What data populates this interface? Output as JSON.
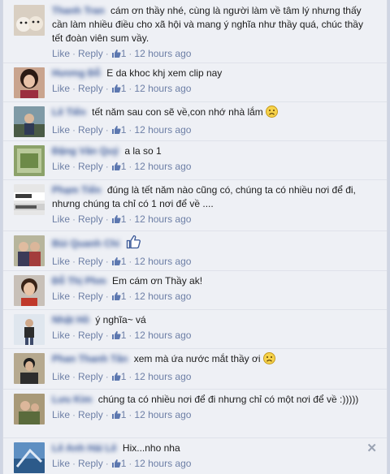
{
  "comments": [
    {
      "name": "Thanh Tran",
      "text": "cám ơn thầy nhé, cùng là người làm về tâm lý nhưng thấy cần làm nhiều điều cho xã hội và mang ý nghĩa như thầy quá, chúc thầy tết đoàn viên sum vầy.",
      "like": "Like",
      "reply": "Reply",
      "count": "1",
      "time": "12 hours ago"
    },
    {
      "name": "Hương Đỗ",
      "text": "E da khoc khj xem clip nay",
      "like": "Like",
      "reply": "Reply",
      "count": "1",
      "time": "12 hours ago"
    },
    {
      "name": "Lê Tiến",
      "text": "tết năm sau con sẽ về,con nhớ nhà lắm",
      "like": "Like",
      "reply": "Reply",
      "count": "1",
      "time": "12 hours ago"
    },
    {
      "name": "Đặng Văn Quý",
      "text": "a la so 1",
      "like": "Like",
      "reply": "Reply",
      "count": "1",
      "time": "12 hours ago"
    },
    {
      "name": "Phạm Tiến",
      "text": "đúng là tết năm nào cũng có, chúng ta có nhiều nơi để đi, nhưng chúng ta chỉ có 1 nơi để về ....",
      "like": "Like",
      "reply": "Reply",
      "count": "1",
      "time": "12 hours ago"
    },
    {
      "name": "Bùi Quanh Chi",
      "text": "",
      "like": "Like",
      "reply": "Reply",
      "count": "1",
      "time": "12 hours ago"
    },
    {
      "name": "Đỗ Thị Phm",
      "text": "Em cám ơn  Thầy ak!",
      "like": "Like",
      "reply": "Reply",
      "count": "1",
      "time": "12 hours ago"
    },
    {
      "name": "Nhật Hồ",
      "text": "ý nghĩa~ vá",
      "like": "Like",
      "reply": "Reply",
      "count": "1",
      "time": "12 hours ago"
    },
    {
      "name": "Phan Thanh Tân",
      "text": "xem mà ứa nước mắt thầy ơi",
      "like": "Like",
      "reply": "Reply",
      "count": "1",
      "time": "12 hours ago"
    },
    {
      "name": "Lưu Kim",
      "text": "chúng ta có nhiều nơi để đi nhưng chỉ có một nơi để về :)))))",
      "like": "Like",
      "reply": "Reply",
      "count": "1",
      "time": "12 hours ago"
    },
    {
      "name": "Lê Anh Hải Lê",
      "text": "Hix...nho nha",
      "like": "Like",
      "reply": "Reply",
      "count": "1",
      "time": "12 hours ago"
    }
  ],
  "close_symbol": "✕",
  "colors": {
    "link": "#3b5998",
    "meta": "#6d7fa6",
    "background": "#eef0f5"
  }
}
